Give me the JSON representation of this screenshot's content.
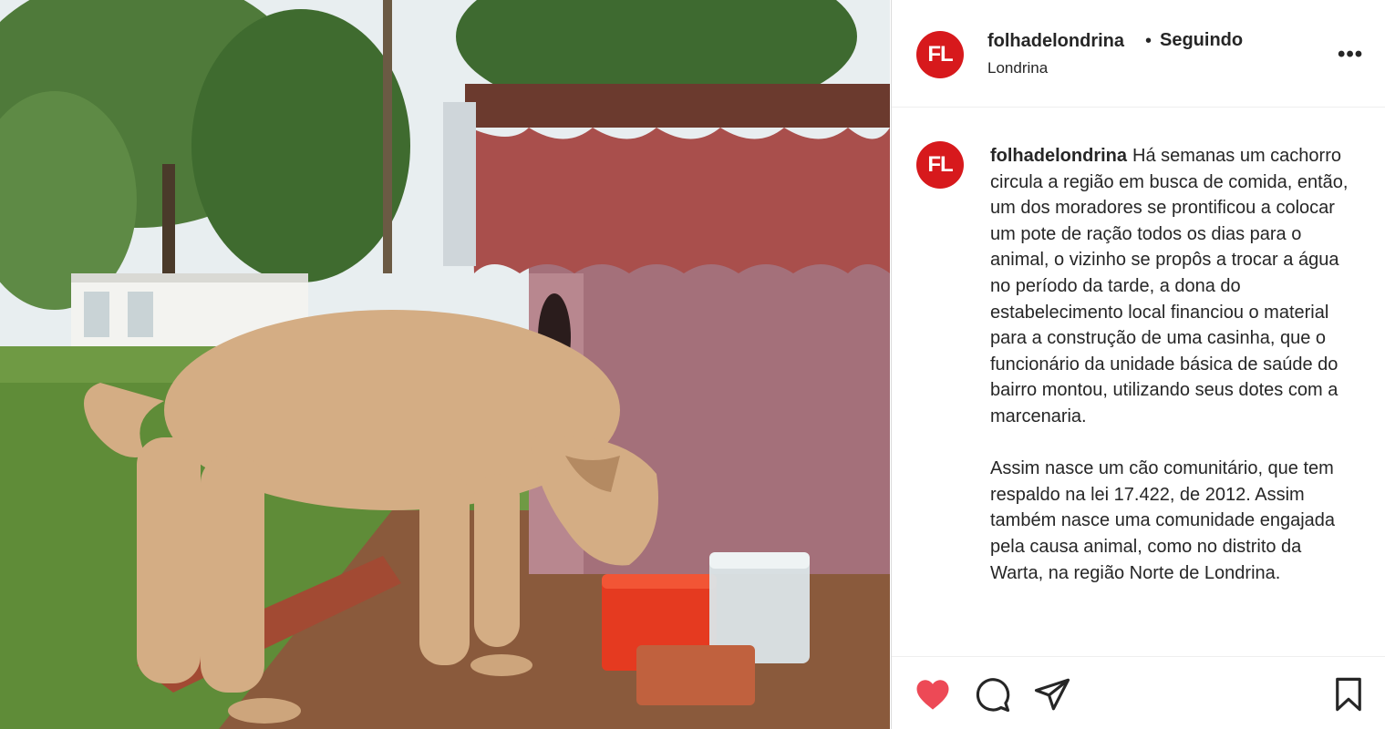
{
  "photo": {
    "alt": "dog-eating-by-doghouse"
  },
  "post_header": {
    "avatar_initials": "FL",
    "username": "folhadelondrina",
    "separator": "•",
    "follow_status": "Seguindo",
    "location": "Londrina",
    "more_label": "•••"
  },
  "caption": {
    "avatar_initials": "FL",
    "username": "folhadelondrina",
    "paragraph1": "Há semanas um cachorro circula a região em busca de comida, então, um dos moradores se prontificou a colocar um pote de ração todos os dias para o animal, o vizinho se propôs a trocar a água no período da tarde, a dona do estabelecimento local financiou o material para a construção de uma casinha, que o funcionário da unidade básica de saúde do bairro montou, utilizando seus dotes com a marcenaria.",
    "paragraph2": "Assim nasce um cão comunitário, que tem respaldo na lei 17.422, de 2012. Assim também nasce uma comunidade engajada pela causa animal, como no distrito da Warta, na região Norte de Londrina."
  },
  "actions": {
    "like_icon": "heart-filled-icon",
    "comment_icon": "comment-icon",
    "share_icon": "paper-plane-icon",
    "save_icon": "bookmark-icon"
  },
  "colors": {
    "brand_red": "#d7191c",
    "like_red": "#ed4956",
    "text": "#262626",
    "muted": "#8e8e8e"
  }
}
